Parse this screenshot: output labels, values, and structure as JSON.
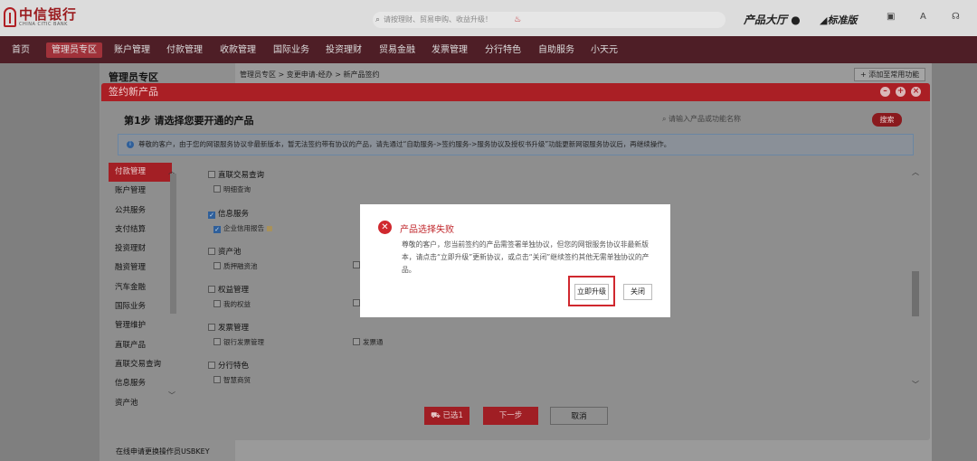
{
  "header": {
    "logo_cn": "中信银行",
    "logo_en": "CHINA CITIC BANK",
    "search_placeholder": "请按理财、贸易申购、收益升级！",
    "product_hall": "产品大厅",
    "version": "标准版",
    "icons": [
      "search-icon",
      "hot-icon",
      "product-hall-icon",
      "standard-version-icon",
      "message-icon",
      "font-size-icon",
      "headset-icon"
    ]
  },
  "nav": {
    "items": [
      "首页",
      "管理员专区",
      "账户管理",
      "付款管理",
      "收款管理",
      "国际业务",
      "投资理财",
      "贸易金融",
      "发票管理",
      "分行特色",
      "自助服务",
      "小天元"
    ],
    "active": "管理员专区"
  },
  "page": {
    "title": "管理员专区",
    "breadcrumb": "管理员专区 > 变更申请-经办 > 新产品签约",
    "add_fav": "+ 添加至常用功能",
    "usbkey": "在线申请更换操作员USBKEY"
  },
  "dialog": {
    "title": "签约新产品",
    "step_title": "第1步 请选择您要开通的产品",
    "search_placeholder": "请输入产品或功能名称",
    "search_button": "搜索",
    "notice": "尊敬的客户，由于您的网银服务协议非最新版本，暂无法签约带有协议的产品，请先通过“自助服务->签约服务->服务协议及授权书升级”功能更新网银服务协议后，再继续操作。",
    "left_nav": [
      "付款管理",
      "账户管理",
      "公共服务",
      "支付结算",
      "投资理财",
      "融资管理",
      "汽车金融",
      "国际业务",
      "管理维护",
      "直联产品",
      "直联交易查询",
      "信息服务",
      "资产池"
    ],
    "left_nav_active": "付款管理",
    "groups": [
      {
        "label": "直联交易查询",
        "checked": false,
        "items": [
          {
            "label": "明细查询",
            "checked": false
          }
        ]
      },
      {
        "label": "信息服务",
        "checked": true,
        "items": [
          {
            "label": "企业信用报告",
            "checked": true
          }
        ]
      },
      {
        "label": "资产池",
        "checked": false,
        "items": [
          {
            "label": "质押融资池",
            "checked": false
          }
        ]
      },
      {
        "label": "权益管理",
        "checked": false,
        "items": [
          {
            "label": "我的权益",
            "checked": false
          }
        ]
      },
      {
        "label": "发票管理",
        "checked": false,
        "items": [
          {
            "label": "银行发票管理",
            "checked": false
          },
          {
            "label": "发票通",
            "checked": false
          }
        ]
      },
      {
        "label": "分行特色",
        "checked": false,
        "items": [
          {
            "label": "智慧商贸",
            "checked": false
          }
        ]
      }
    ],
    "selected_button": "已选1",
    "next_button": "下一步",
    "cancel_button": "取消"
  },
  "alert": {
    "title": "产品选择失败",
    "body": "尊敬的客户，您当前签约的产品需签署单独协议，但您的网银服务协议非最新版本，请点击“立即升级”更新协议，或点击“关闭”继续签约其他无需单独协议的产品。",
    "upgrade_button": "立即升级",
    "close_button": "关闭",
    "highlight_color": "#d0282e"
  }
}
